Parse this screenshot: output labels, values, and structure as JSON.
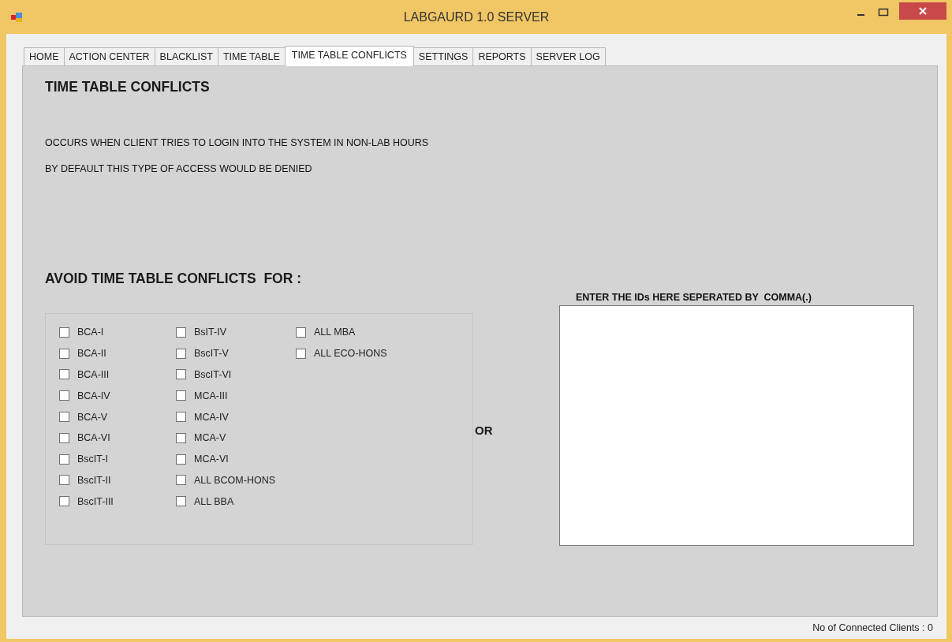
{
  "window": {
    "title": "LABGAURD 1.0 SERVER"
  },
  "tabs": [
    {
      "label": "HOME",
      "selected": false
    },
    {
      "label": "ACTION CENTER",
      "selected": false
    },
    {
      "label": "BLACKLIST",
      "selected": false
    },
    {
      "label": "TIME TABLE",
      "selected": false
    },
    {
      "label": "TIME TABLE CONFLICTS",
      "selected": true
    },
    {
      "label": "SETTINGS",
      "selected": false
    },
    {
      "label": "REPORTS",
      "selected": false
    },
    {
      "label": "SERVER LOG",
      "selected": false
    }
  ],
  "page": {
    "heading": "TIME TABLE CONFLICTS",
    "description": [
      "OCCURS WHEN CLIENT TRIES TO LOGIN INTO THE SYSTEM IN NON-LAB HOURS",
      "BY DEFAULT THIS TYPE OF ACCESS WOULD BE DENIED"
    ],
    "avoid_heading": "AVOID TIME TABLE CONFLICTS  FOR :",
    "checkbox_columns": [
      [
        {
          "label": "BCA-I",
          "checked": false
        },
        {
          "label": "BCA-II",
          "checked": false
        },
        {
          "label": "BCA-III",
          "checked": false
        },
        {
          "label": "BCA-IV",
          "checked": false
        },
        {
          "label": "BCA-V",
          "checked": false
        },
        {
          "label": "BCA-VI",
          "checked": false
        },
        {
          "label": "BscIT-I",
          "checked": false
        },
        {
          "label": "BscIT-II",
          "checked": false
        },
        {
          "label": "BscIT-III",
          "checked": false
        }
      ],
      [
        {
          "label": "BsIT-IV",
          "checked": false
        },
        {
          "label": "BscIT-V",
          "checked": false
        },
        {
          "label": "BscIT-VI",
          "checked": false
        },
        {
          "label": "MCA-III",
          "checked": false
        },
        {
          "label": "MCA-IV",
          "checked": false
        },
        {
          "label": "MCA-V",
          "checked": false
        },
        {
          "label": "MCA-VI",
          "checked": false
        },
        {
          "label": "ALL BCOM-HONS",
          "checked": false
        },
        {
          "label": "ALL BBA",
          "checked": false
        }
      ],
      [
        {
          "label": "ALL MBA",
          "checked": false
        },
        {
          "label": "ALL ECO-HONS",
          "checked": false
        }
      ]
    ],
    "separator": "OR",
    "ids_field": {
      "label": "ENTER THE IDs HERE SEPERATED BY  COMMA(.)"
    }
  },
  "status_bar": {
    "connected_clients": "No of Connected Clients : 0"
  }
}
